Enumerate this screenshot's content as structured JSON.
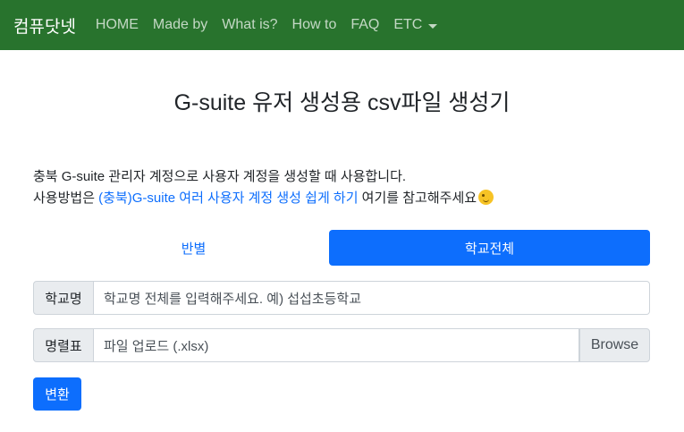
{
  "navbar": {
    "brand": "컴퓨닷넷",
    "items": [
      {
        "label": "HOME"
      },
      {
        "label": "Made by"
      },
      {
        "label": "What is?"
      },
      {
        "label": "How to"
      },
      {
        "label": "FAQ"
      },
      {
        "label": "ETC"
      }
    ],
    "background": "#28732d"
  },
  "page": {
    "title": "G-suite 유저 생성용 csv파일 생성기",
    "desc_line1": "충북 G-suite 관리자 계정으로 사용자 계정을 생성할 때 사용합니다.",
    "desc_line2_prefix": "사용방법은 ",
    "desc_link": "(충북)G-suite 여러 사용자 계정 생성 쉽게 하기",
    "desc_line2_suffix": " 여기를 참고해주세요",
    "emoji": "wink-emoji"
  },
  "tabs": [
    {
      "label": "반별",
      "active": false
    },
    {
      "label": "학교전체",
      "active": true
    }
  ],
  "form": {
    "school_label": "학교명",
    "school_placeholder": "학교명 전체를 입력해주세요. 예) 섭섭초등학교",
    "roster_label": "명렬표",
    "file_placeholder": "파일 업로드 (.xlsx)",
    "browse_label": "Browse",
    "convert_label": "변환"
  },
  "colors": {
    "accent": "#0d6efd"
  }
}
